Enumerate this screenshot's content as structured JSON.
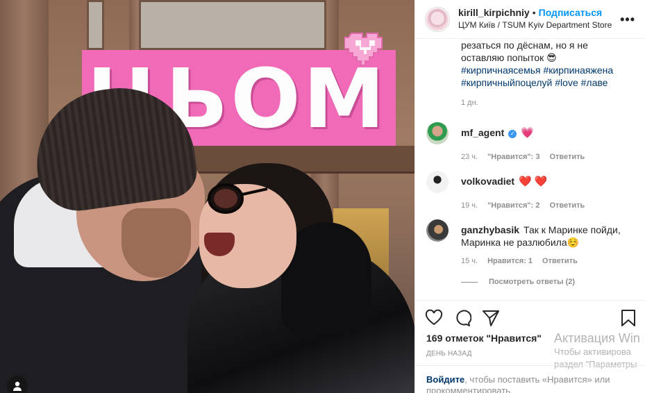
{
  "header": {
    "username": "kirill_kirpichniy",
    "dot": "•",
    "follow_label": "Подписаться",
    "location": "ЦУМ Київ / TSUM Kyiv Department Store",
    "more_label": "•••"
  },
  "photo": {
    "sign_text": "ЦЬОМ",
    "sign_color": "#f06ab8"
  },
  "caption": {
    "line1": "резаться по дёснам, но я не",
    "line2": "оставляю попыток 😎",
    "hashtags_line1": "#кирпичнаясемья #кирпинаяжена",
    "hashtags_line2": "#кирпичныйпоцелуй #love #лаве",
    "time": "1 дн."
  },
  "comments": [
    {
      "user": "mf_agent",
      "verified": "✓",
      "text": "💗",
      "time": "23 ч.",
      "likes": "\"Нравится\": 3",
      "reply": "Ответить"
    },
    {
      "user": "volkovadiet",
      "text": "❤️ ❤️",
      "time": "19 ч.",
      "likes": "\"Нравится\": 2",
      "reply": "Ответить"
    },
    {
      "user": "ganzhybasik",
      "text_line1": "Так к Маринке пойди,",
      "text_line2": "Маринка не разлюбила☺️",
      "time": "15 ч.",
      "likes": "Нравится: 1",
      "reply": "Ответить"
    }
  ],
  "view_replies": "Посмотреть ответы (2)",
  "actions": {
    "like_icon": "heart-icon",
    "comment_icon": "comment-icon",
    "share_icon": "share-icon",
    "save_icon": "bookmark-icon"
  },
  "likes_text": "169 отметок \"Нравится\"",
  "post_time": "ДЕНЬ НАЗАД",
  "activation": {
    "title": "Активация Win",
    "line1": "Чтобы активирова",
    "line2": "раздел \"Параметры"
  },
  "login": {
    "link": "Войдите",
    "text": ", чтобы поставить «Нравится» или",
    "text2": "прокомментировать."
  },
  "colors": {
    "accent": "#0095f6",
    "link": "#00376b",
    "muted": "#8e8e8e"
  }
}
